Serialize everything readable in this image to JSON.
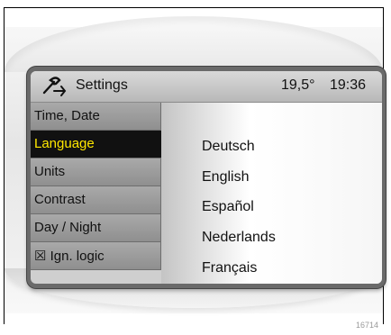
{
  "header": {
    "title": "Settings",
    "temperature": "19,5°",
    "time": "19:36",
    "icon": "settings-wrench-icon"
  },
  "menu": {
    "items": [
      {
        "label": "Time, Date"
      },
      {
        "label": "Language"
      },
      {
        "label": "Units"
      },
      {
        "label": "Contrast"
      },
      {
        "label": "Day / Night"
      },
      {
        "label": "☒ Ign. logic"
      }
    ],
    "selected": "Language"
  },
  "languages": {
    "options": [
      "Deutsch",
      "English",
      "Español",
      "Nederlands",
      "Français"
    ]
  },
  "colors": {
    "selected_text": "#ffe800",
    "selected_bg": "#111111"
  },
  "footer": {
    "caption": "16714"
  }
}
